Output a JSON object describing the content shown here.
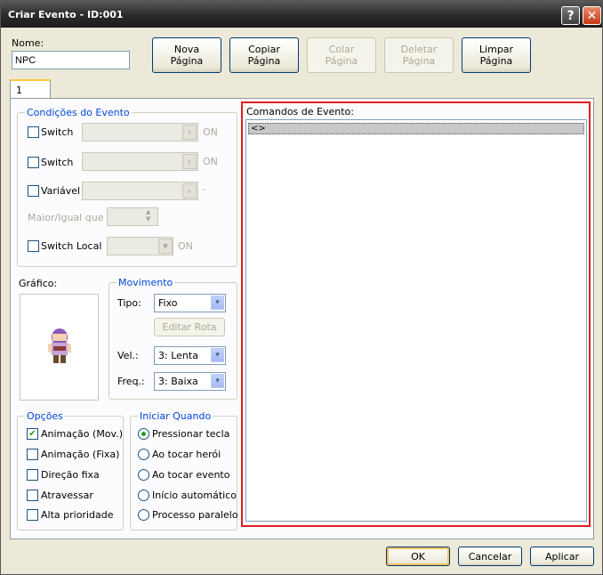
{
  "window": {
    "title": "Criar Evento - ID:001"
  },
  "name_field": {
    "label": "Nome:",
    "value": "NPC"
  },
  "page_buttons": {
    "new_page": "Nova\nPágina",
    "copy_page": "Copiar\nPágina",
    "paste_page": "Colar\nPágina",
    "delete_page": "Deletar\nPágina",
    "clear_page": "Limpar\nPágina"
  },
  "tabs": [
    {
      "label": "1"
    }
  ],
  "conditions": {
    "title": "Condições do Evento",
    "switch1": {
      "label": "Switch",
      "state": "ON",
      "checked": false
    },
    "switch2": {
      "label": "Switch",
      "state": "ON",
      "checked": false
    },
    "variable": {
      "label": "Variável",
      "suffix": "-",
      "checked": false
    },
    "greater_equal": {
      "label": "Maior/Igual que"
    },
    "self_switch": {
      "label": "Switch Local",
      "state": "ON",
      "checked": false
    }
  },
  "graphic": {
    "label": "Gráfico:"
  },
  "movement": {
    "title": "Movimento",
    "type_label": "Tipo:",
    "type_value": "Fixo",
    "edit_route": "Editar Rota",
    "speed_label": "Vel.:",
    "speed_value": "3: Lenta",
    "freq_label": "Freq.:",
    "freq_value": "3: Baixa"
  },
  "options": {
    "title": "Opções",
    "items": [
      {
        "label": "Animação (Mov.)",
        "checked": true
      },
      {
        "label": "Animação (Fixa)",
        "checked": false
      },
      {
        "label": "Direção fixa",
        "checked": false
      },
      {
        "label": "Atravessar",
        "checked": false
      },
      {
        "label": "Alta prioridade",
        "checked": false
      }
    ]
  },
  "trigger": {
    "title": "Iniciar Quando",
    "items": [
      {
        "label": "Pressionar tecla",
        "selected": true
      },
      {
        "label": "Ao tocar herói",
        "selected": false
      },
      {
        "label": "Ao tocar evento",
        "selected": false
      },
      {
        "label": "Início automático",
        "selected": false
      },
      {
        "label": "Processo paralelo",
        "selected": false
      }
    ]
  },
  "commands": {
    "label": "Comandos de Evento:",
    "rows": [
      "<>"
    ]
  },
  "footer": {
    "ok": "OK",
    "cancel": "Cancelar",
    "apply": "Aplicar"
  },
  "colors": {
    "accent_red": "#e01f1f",
    "group_title": "#0046d5",
    "check_green": "#21a121"
  },
  "icons": {
    "help": "question-icon",
    "close": "close-icon",
    "checkmark": "✔",
    "arrow_right": "›",
    "arrow_down": "▾"
  }
}
